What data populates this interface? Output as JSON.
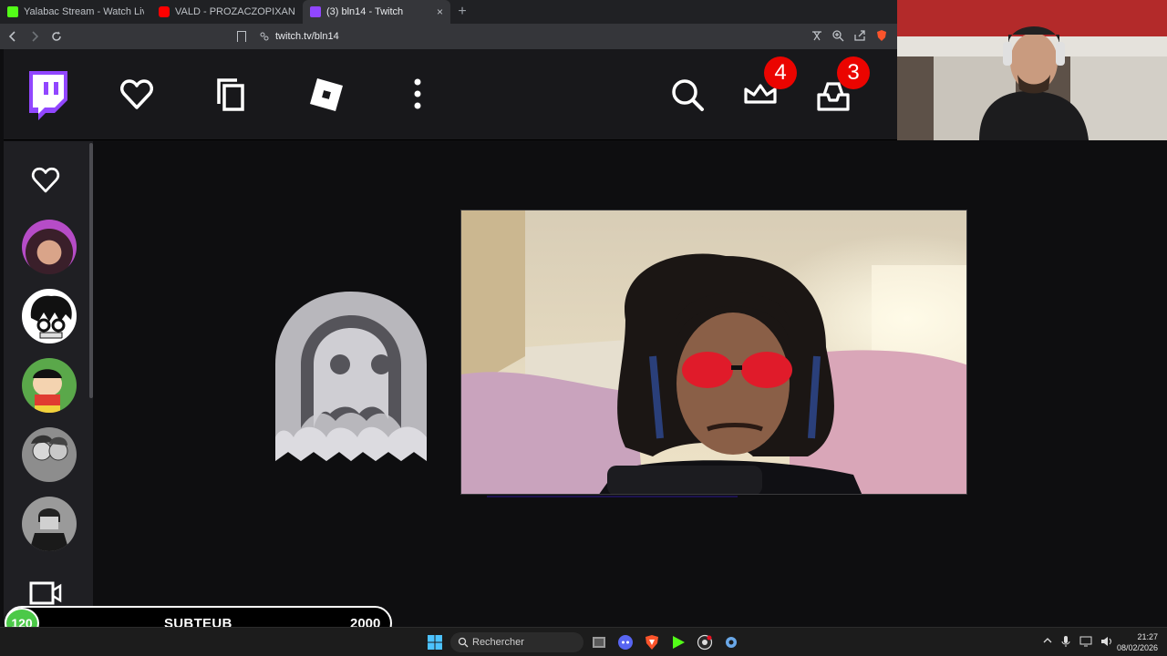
{
  "browser": {
    "tabs": [
      {
        "title": "Yalabac Stream - Watch Live on Kick",
        "favicon_color": "#53fc18",
        "active": false
      },
      {
        "title": "VALD - PROZACZOPIXAN (Clip offici",
        "favicon_color": "#ff0000",
        "active": false
      },
      {
        "title": "(3) bln14 - Twitch",
        "favicon_color": "#9146ff",
        "active": true
      }
    ],
    "close_glyph": "×",
    "new_tab_glyph": "+",
    "url": "twitch.tv/bln14"
  },
  "twitch": {
    "accent": "#9146ff",
    "notifications": {
      "prime_count": "4",
      "inbox_count": "3"
    },
    "nav_icons": [
      "heart-icon",
      "copy-icon",
      "roblox-icon",
      "more-vertical-icon",
      "search-icon",
      "crown-icon",
      "inbox-icon"
    ],
    "sidebar": {
      "followed_icon": "heart-icon",
      "channels": [
        "channel-avatar-1",
        "channel-avatar-2",
        "channel-avatar-3",
        "channel-avatar-4",
        "channel-avatar-5"
      ],
      "bottom_icon": "video-camera-icon"
    }
  },
  "overlay": {
    "sub_count": "120",
    "label": "SUBTEUB",
    "goal": "2000"
  },
  "taskbar": {
    "search_placeholder": "Rechercher",
    "time": "21:27",
    "date": "08/02/2026"
  }
}
